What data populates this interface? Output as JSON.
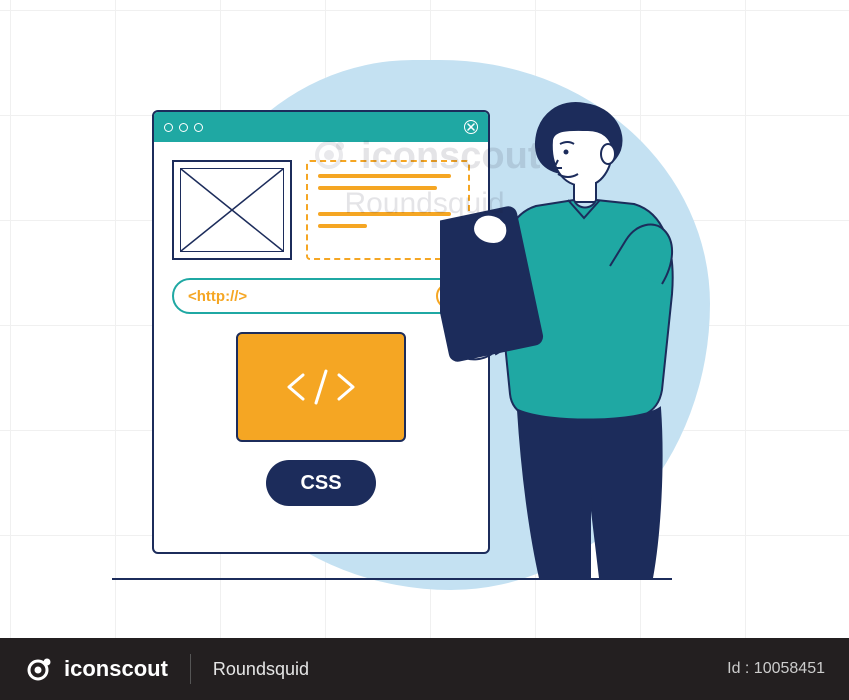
{
  "illustration": {
    "url_text": "<http://>",
    "css_label": "CSS"
  },
  "watermark": {
    "brand": "iconscout",
    "contributor": "Roundsquid"
  },
  "footer": {
    "brand": "iconscout",
    "author": "Roundsquid",
    "image_id": "Id : 10058451"
  }
}
